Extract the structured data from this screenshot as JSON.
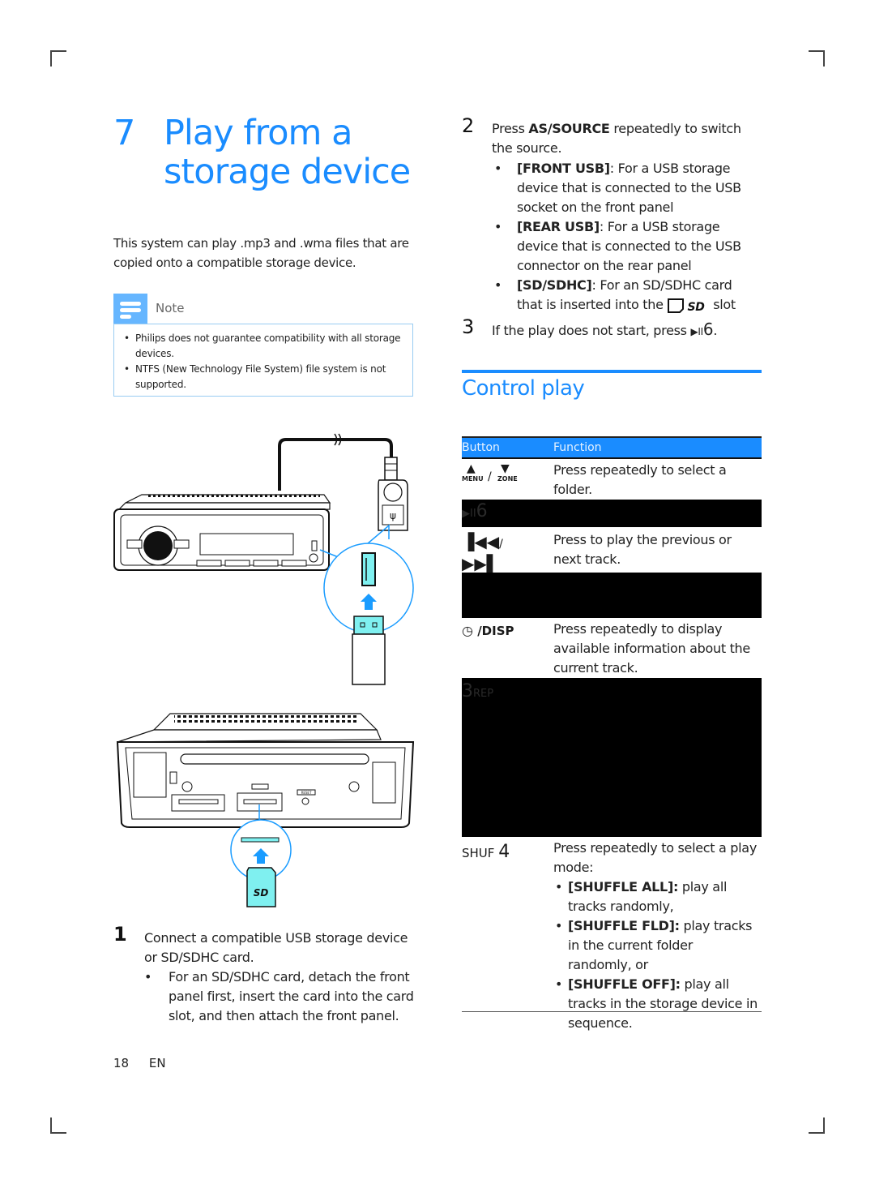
{
  "page": {
    "chapter_number": "7",
    "chapter_title_line1": "Play from a",
    "chapter_title_line2": "storage device",
    "intro": "This system can play .mp3 and .wma files that are copied onto a compatible storage device.",
    "footer": {
      "page_number": "18",
      "language": "EN"
    }
  },
  "note": {
    "label": "Note",
    "items": [
      "Philips does not guarantee compatibility with all storage devices.",
      "NTFS (New Technology File System) file system is not supported."
    ]
  },
  "illustrations": {
    "front_usb_callout": "usb-front-socket-illustration",
    "sd_slot_callout": "sd-card-slot-illustration",
    "reset_label": "RESET",
    "sd_card_label": "SD"
  },
  "steps": {
    "step1": {
      "number": "1",
      "text": "Connect a compatible USB storage device or SD/SDHC card.",
      "bullets": [
        "For an SD/SDHC card, detach the front panel first, insert the card into the card slot, and then attach the front panel."
      ]
    },
    "step2": {
      "number": "2",
      "prefix": "Press ",
      "button": "AS/SOURCE",
      "suffix": " repeatedly to switch the source.",
      "bullets": [
        {
          "label": "[FRONT USB]",
          "text": ": For a USB storage device that is connected to the USB socket on the front panel"
        },
        {
          "label": "[REAR USB]",
          "text": ": For a USB storage device that is connected to the USB connector on the rear panel"
        },
        {
          "label": "[SD/SDHC]",
          "text": ": For an SD/SDHC card that is inserted into the",
          "after_icon": " slot"
        }
      ]
    },
    "step3": {
      "number": "3",
      "text": "If the play does not start, press ",
      "button_num": "6",
      "end": "."
    }
  },
  "control_play": {
    "title": "Control play",
    "headers": {
      "button": "Button",
      "function": "Function"
    },
    "rows": [
      {
        "button_up": "MENU",
        "sep": "/",
        "button_down": "ZONE",
        "function": "Press repeatedly to select a folder."
      },
      {
        "button": "6",
        "function": "",
        "redacted": true
      },
      {
        "sep": "/",
        "function": "Press to play the previous or next track."
      },
      {
        "button": "",
        "function": "",
        "redacted": true
      },
      {
        "button": "/DISP",
        "function": "Press repeatedly to display available information about the current track."
      },
      {
        "button_num": "3",
        "button": "REP",
        "function": "",
        "redacted": true
      },
      {
        "button": "SHUF",
        "button_num": "4",
        "function": "Press repeatedly to select a play mode:",
        "modes": [
          {
            "label": "[SHUFFLE ALL]:",
            "text": " play all tracks randomly,"
          },
          {
            "label": "[SHUFFLE FLD]:",
            "text": " play tracks in the current folder randomly, or"
          },
          {
            "label": "[SHUFFLE OFF]:",
            "text": " play all tracks in the storage device in sequence."
          }
        ]
      }
    ]
  },
  "colors": {
    "accent_blue": "#1a8cff",
    "note_blue": "#66b6ff",
    "callout_cyan": "#7ff0f0"
  }
}
